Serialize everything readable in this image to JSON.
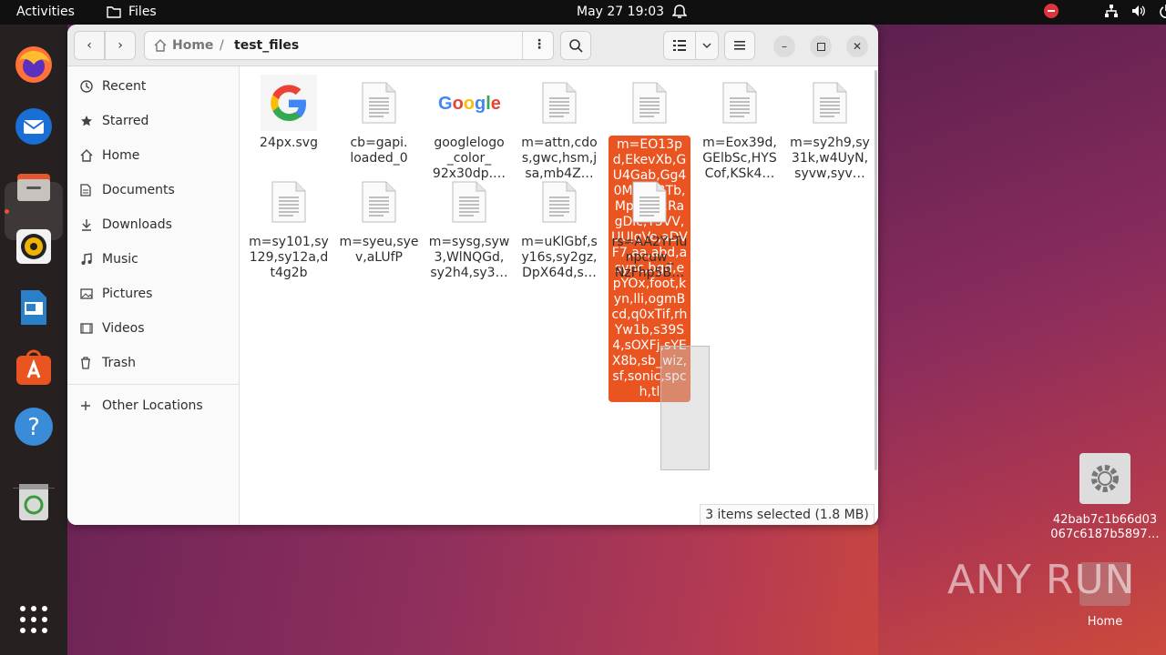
{
  "topbar": {
    "activities": "Activities",
    "app_name": "Files",
    "clock": "May 27  19:03"
  },
  "dock": {
    "items": [
      "firefox-icon",
      "thunderbird-icon",
      "files-icon",
      "rhythmbox-icon",
      "writer-icon",
      "app-center-icon",
      "help-icon",
      "trash-icon",
      "show-apps-icon"
    ]
  },
  "window": {
    "path": {
      "home": "Home",
      "separator": "/",
      "current": "test_files"
    },
    "sidebar": [
      {
        "label": "Recent",
        "icon": "clock-icon"
      },
      {
        "label": "Starred",
        "icon": "star-icon"
      },
      {
        "label": "Home",
        "icon": "home-icon"
      },
      {
        "label": "Documents",
        "icon": "document-icon"
      },
      {
        "label": "Downloads",
        "icon": "download-icon"
      },
      {
        "label": "Music",
        "icon": "music-icon"
      },
      {
        "label": "Pictures",
        "icon": "picture-icon"
      },
      {
        "label": "Videos",
        "icon": "video-icon"
      },
      {
        "label": "Trash",
        "icon": "trash-icon"
      },
      {
        "label": "Other Locations",
        "icon": "plus-icon"
      }
    ],
    "files": [
      {
        "name": "24px.svg",
        "type": "google-g"
      },
      {
        "name": "cb=gapi.\nloaded_0",
        "type": "doc"
      },
      {
        "name": "googlelogo\n_color_\n92x30dp.…",
        "type": "google-logo"
      },
      {
        "name": "m=attn,cdo\ns,gwc,hsm,j\nsa,mb4Z…",
        "type": "doc"
      },
      {
        "name": "m=EO13pd,EkevXb,GU4Gab,Gg40M,IX53Tb,MpJwZc,RagDlc,T5VV,UUJqVe,aDVF7,aa,abd,async,bgd,epYOx,foot,kyn,lli,ogmBcd,q0xTif,rhYw1b,s39S4,sOXFj,sYEX8b,sb_wiz,sf,sonic,spch,tl",
        "type": "doc",
        "selected": true
      },
      {
        "name": "m=Eox39d,\nGElbSc,HYS\nCof,KSk4…",
        "type": "doc"
      },
      {
        "name": "m=sy2h9,sy\n31k,w4UyN,\nsyvw,syv…",
        "type": "doc"
      },
      {
        "name": "m=sy101,sy\n129,sy12a,d\nt4g2b",
        "type": "doc"
      },
      {
        "name": "m=syeu,sye\nv,aLUfP",
        "type": "doc"
      },
      {
        "name": "m=sysg,syw\n3,WlNQGd,\nsy2h4,sy3…",
        "type": "doc"
      },
      {
        "name": "m=uKlGbf,s\ny16s,sy2gz,\nDpX64d,s…",
        "type": "doc"
      },
      {
        "name": "rs=AA2YrTu\nnpcuw_\nNzFhp5B…",
        "type": "doc"
      }
    ],
    "status": "3 items selected  (1.8 MB)"
  },
  "desktop": {
    "file_icon_label": "42bab7c1b66d03\n067c6187b5897…",
    "home_label": "Home",
    "watermark": "ANY RUN"
  },
  "colors": {
    "accent": "#e95420",
    "topbar": "#101010",
    "dock": "#262020"
  }
}
